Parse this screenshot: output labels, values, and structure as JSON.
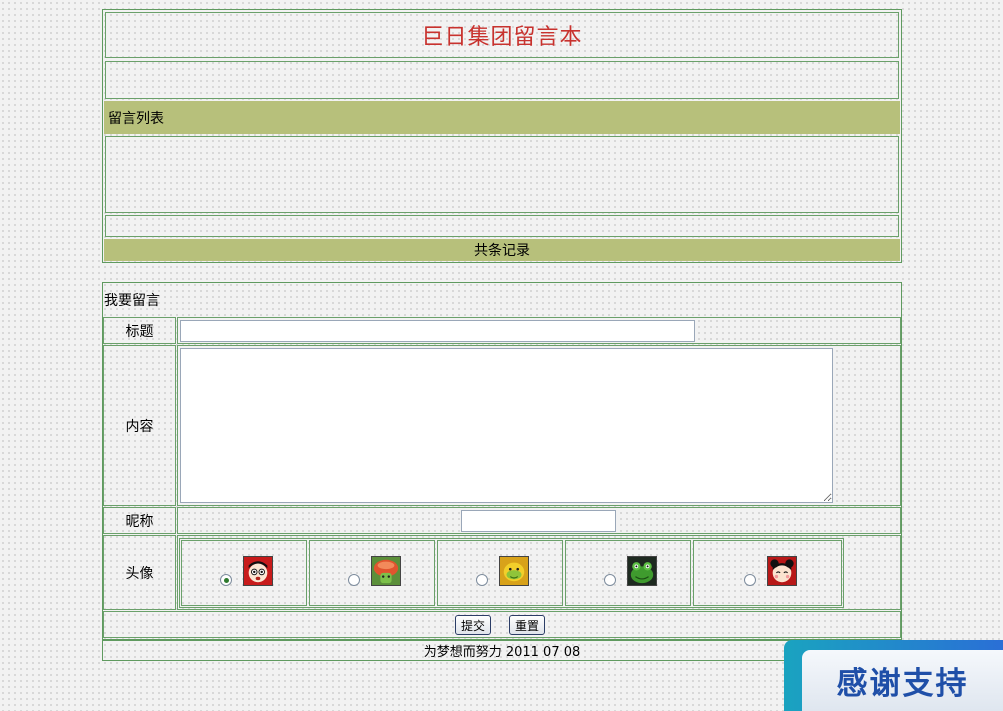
{
  "header": {
    "title": "巨日集团留言本"
  },
  "list_section": {
    "heading": "留言列表",
    "total_records": "共条记录"
  },
  "form": {
    "heading": "我要留言",
    "title_label": "标题",
    "title_value": "",
    "content_label": "内容",
    "content_value": "",
    "nickname_label": "昵称",
    "nickname_value": "",
    "avatar_label": "头像",
    "avatars": [
      {
        "icon": "pucca-red-avatar-icon",
        "selected": true
      },
      {
        "icon": "green-mushroom-avatar-icon",
        "selected": false
      },
      {
        "icon": "yellow-bean-avatar-icon",
        "selected": false
      },
      {
        "icon": "green-frog-avatar-icon",
        "selected": false
      },
      {
        "icon": "pucca-girl-avatar-icon",
        "selected": false
      }
    ],
    "submit_label": "提交",
    "reset_label": "重置"
  },
  "footer": {
    "text": "为梦想而努力 2011 07 08"
  },
  "banner": {
    "text": "感谢支持"
  },
  "colors": {
    "title": "#c8322e",
    "olive_bar": "#b7c07b",
    "border": "#5f9a5f"
  }
}
